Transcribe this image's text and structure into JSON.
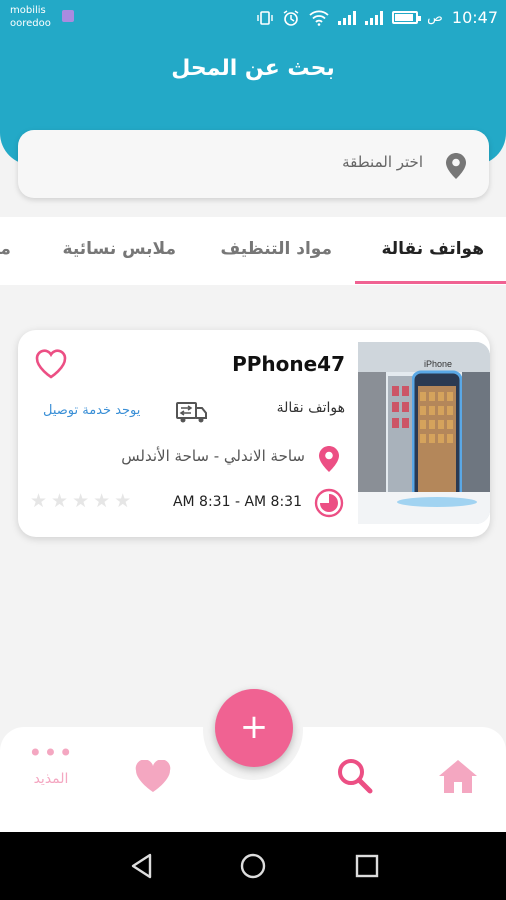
{
  "status_bar": {
    "carrier_line1": "mobilis",
    "carrier_line2": "ooredoo",
    "time": "10:47",
    "ampm": "ص"
  },
  "header": {
    "title": "بحث عن المحل"
  },
  "search": {
    "placeholder": "اختر المنطقة",
    "icon": "location-pin-icon"
  },
  "tabs": [
    {
      "label": "هواتف نقالة",
      "active": true
    },
    {
      "label": "مواد التنظيف",
      "active": false
    },
    {
      "label": "ملابس نسائية",
      "active": false
    },
    {
      "label": "ما",
      "active": false
    }
  ],
  "shop_card": {
    "name": "PPhone47",
    "category": "هواتف نقالة",
    "delivery": "يوجد خدمة توصيل",
    "address": "ساحة الاندلي -  ساحة الأندلس",
    "hours": "AM 8:31   -   AM 8:31",
    "rating": 0,
    "rating_max": 5,
    "photo_sign": "iPhone"
  },
  "bottom_nav": {
    "more_label": "المذيد",
    "fab_label": "+"
  },
  "colors": {
    "header": "#23a9c7",
    "accent": "#f06292",
    "link": "#3a8fd6"
  }
}
